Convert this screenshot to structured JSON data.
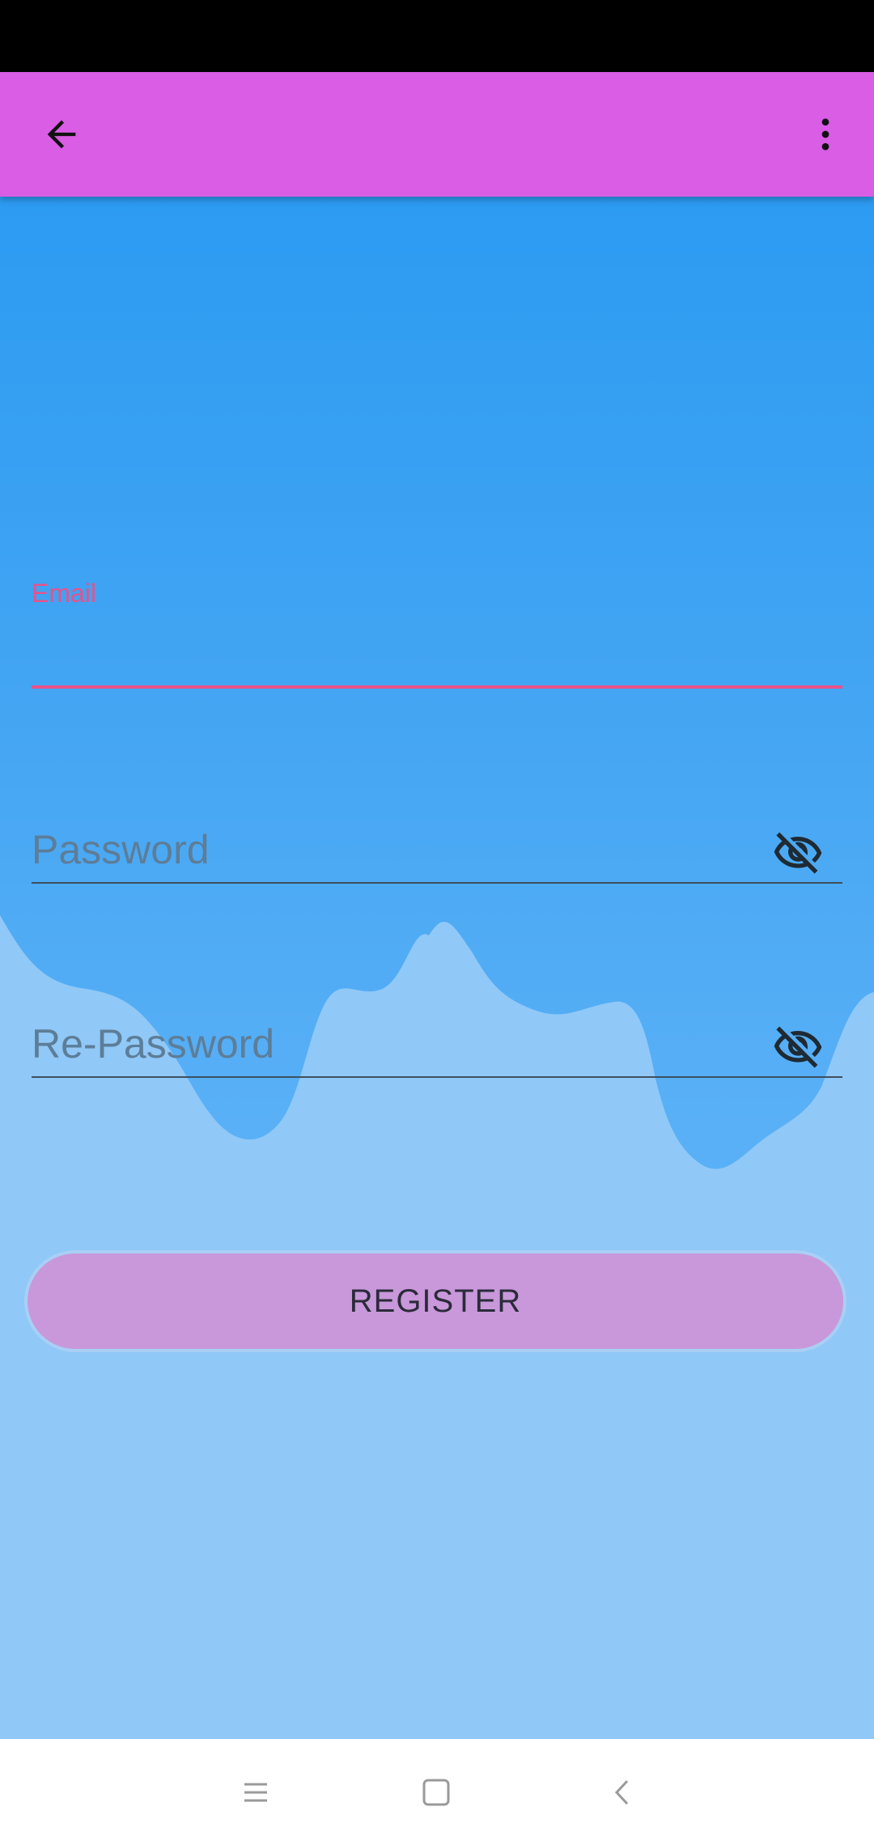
{
  "status_bar": {},
  "app_bar": {
    "back_icon": "arrow-back-icon",
    "more_icon": "more-vert-icon",
    "color": "#d95de5"
  },
  "form": {
    "email": {
      "label": "Email",
      "value": "",
      "focused": true,
      "accent_color": "#e8528a"
    },
    "password": {
      "placeholder": "Password",
      "value": "",
      "visibility_icon": "visibility-off-icon"
    },
    "re_password": {
      "placeholder": "Re-Password",
      "value": "",
      "visibility_icon": "visibility-off-icon"
    },
    "register_button": {
      "label": "REGISTER",
      "color": "#c898da"
    }
  },
  "background": {
    "gradient_top": "#2c9bf2",
    "gradient_bottom": "#5db3f7",
    "wave_color": "#90c8f7"
  },
  "nav_bar": {
    "recents_icon": "menu-lines-icon",
    "home_icon": "square-home-icon",
    "back_icon": "chevron-back-icon"
  }
}
